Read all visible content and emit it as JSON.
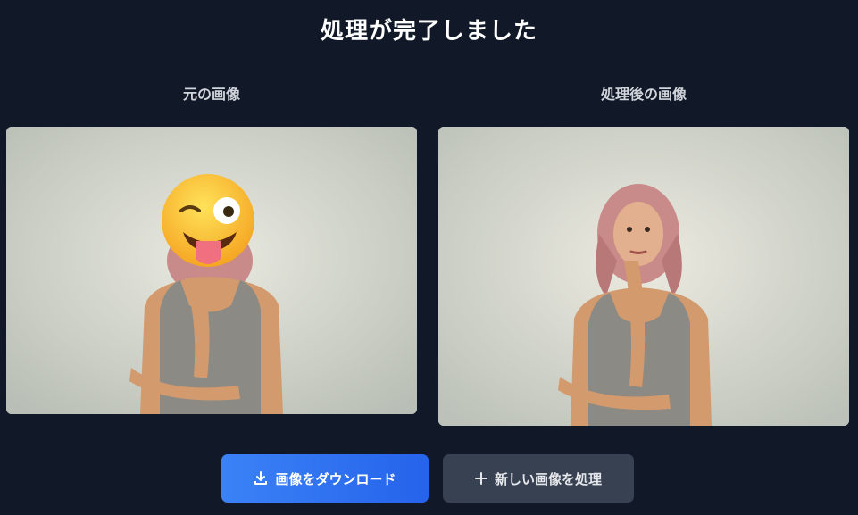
{
  "header": {
    "title": "処理が完了しました"
  },
  "original": {
    "label": "元の画像"
  },
  "processed": {
    "label": "処理後の画像"
  },
  "actions": {
    "download_label": "画像をダウンロード",
    "new_label": "新しい画像を処理"
  },
  "icons": {
    "download": "download-icon",
    "plus": "plus-icon",
    "emoji": "winking-tongue-emoji"
  },
  "colors": {
    "background": "#111827",
    "primary": "#3b82f6",
    "secondary": "#374151"
  }
}
